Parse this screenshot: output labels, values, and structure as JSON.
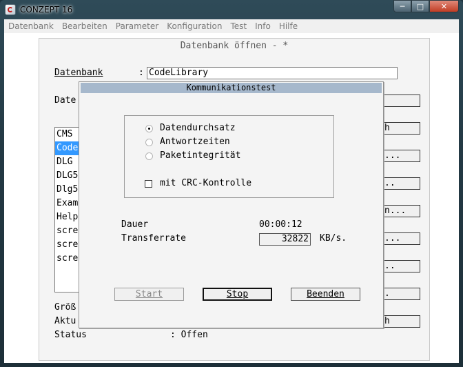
{
  "app": {
    "title": "CONZEPT 16",
    "min_glyph": "─",
    "max_glyph": "□",
    "close_glyph": "✕"
  },
  "menu": [
    "Datenbank",
    "Bearbeiten",
    "Parameter",
    "Konfiguration",
    "Test",
    "Info",
    "Hilfe"
  ],
  "bg_dialog": {
    "title": "Datenbank öffnen - *",
    "datenbank_label": "Datenbank",
    "datenbank_colon": ":",
    "datenbank_value": "CodeLibrary",
    "dateien_label_partial": "Date",
    "list_items": [
      "CMS",
      "Code",
      "DLG",
      "DLG5",
      "Dlg5",
      "Exam",
      "Help",
      "scre",
      "scre",
      "scre"
    ],
    "buttons_partial": [
      "",
      "h",
      "...",
      "..",
      "n...",
      "...",
      "..",
      ".",
      "h"
    ],
    "groesse_label_partial": "Größ",
    "aktu_label_partial": "Aktu",
    "status_label": "Status",
    "status_value": ": Offen"
  },
  "dialog": {
    "title": "Kommunikationstest",
    "radios": [
      {
        "label": "Datendurchsatz",
        "selected": true
      },
      {
        "label": "Antwortzeiten",
        "selected": false
      },
      {
        "label": "Paketintegrität",
        "selected": false
      }
    ],
    "checkbox": {
      "label": "mit CRC-Kontrolle",
      "checked": false
    },
    "dauer_label": "Dauer",
    "dauer_value": "00:00:12",
    "transferrate_label": "Transferrate",
    "transferrate_value": "32822",
    "transferrate_unit": "KB/s.",
    "start_label": "Start",
    "stop_label": "Stop",
    "beenden_label": "Beenden"
  }
}
